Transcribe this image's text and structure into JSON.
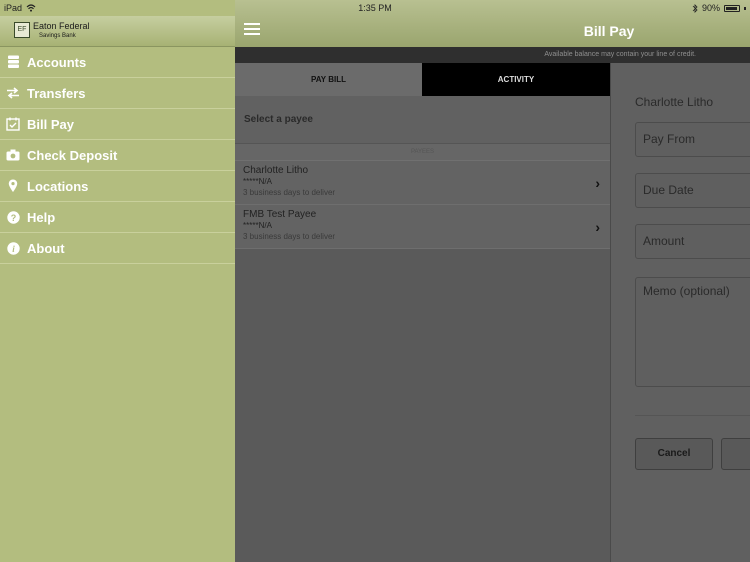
{
  "status": {
    "device": "iPad",
    "time": "1:35 PM",
    "battery": "90%",
    "wifi_icon": "wifi-icon",
    "bluetooth_icon": "bluetooth-icon"
  },
  "brand": {
    "logo_text": "EF",
    "name": "Eaton Federal",
    "subname": "Savings Bank"
  },
  "sidebar": {
    "items": [
      {
        "label": "Accounts",
        "icon": "accounts-icon"
      },
      {
        "label": "Transfers",
        "icon": "transfer-icon"
      },
      {
        "label": "Bill Pay",
        "icon": "calendar-check-icon"
      },
      {
        "label": "Check Deposit",
        "icon": "camera-icon"
      },
      {
        "label": "Locations",
        "icon": "map-pin-icon"
      },
      {
        "label": "Help",
        "icon": "help-icon"
      },
      {
        "label": "About",
        "icon": "info-icon"
      }
    ]
  },
  "header": {
    "title": "Bill Pay",
    "notice": "Available balance may contain your line of credit."
  },
  "tabs": [
    {
      "label": "PAY BILL",
      "active": true
    },
    {
      "label": "ACTIVITY",
      "active": false
    }
  ],
  "list": {
    "select_label": "Select a payee",
    "section_label": "PAYEES",
    "payees": [
      {
        "name": "Charlotte Litho",
        "account": "*****N/A",
        "delivery": "3 business days to deliver"
      },
      {
        "name": "FMB Test Payee",
        "account": "*****N/A",
        "delivery": "3 business days to deliver"
      }
    ]
  },
  "form": {
    "payee_name": "Charlotte Litho",
    "pay_from_placeholder": "Pay From",
    "due_date_placeholder": "Due Date",
    "amount_placeholder": "Amount",
    "memo_placeholder": "Memo (optional)",
    "cancel_label": "Cancel"
  },
  "colors": {
    "sidebar_bg": "#b3bd7f",
    "header_bg": "#9aa56e",
    "tab_active_bg": "#6b6b6b",
    "tab_inactive_bg": "#000000"
  }
}
